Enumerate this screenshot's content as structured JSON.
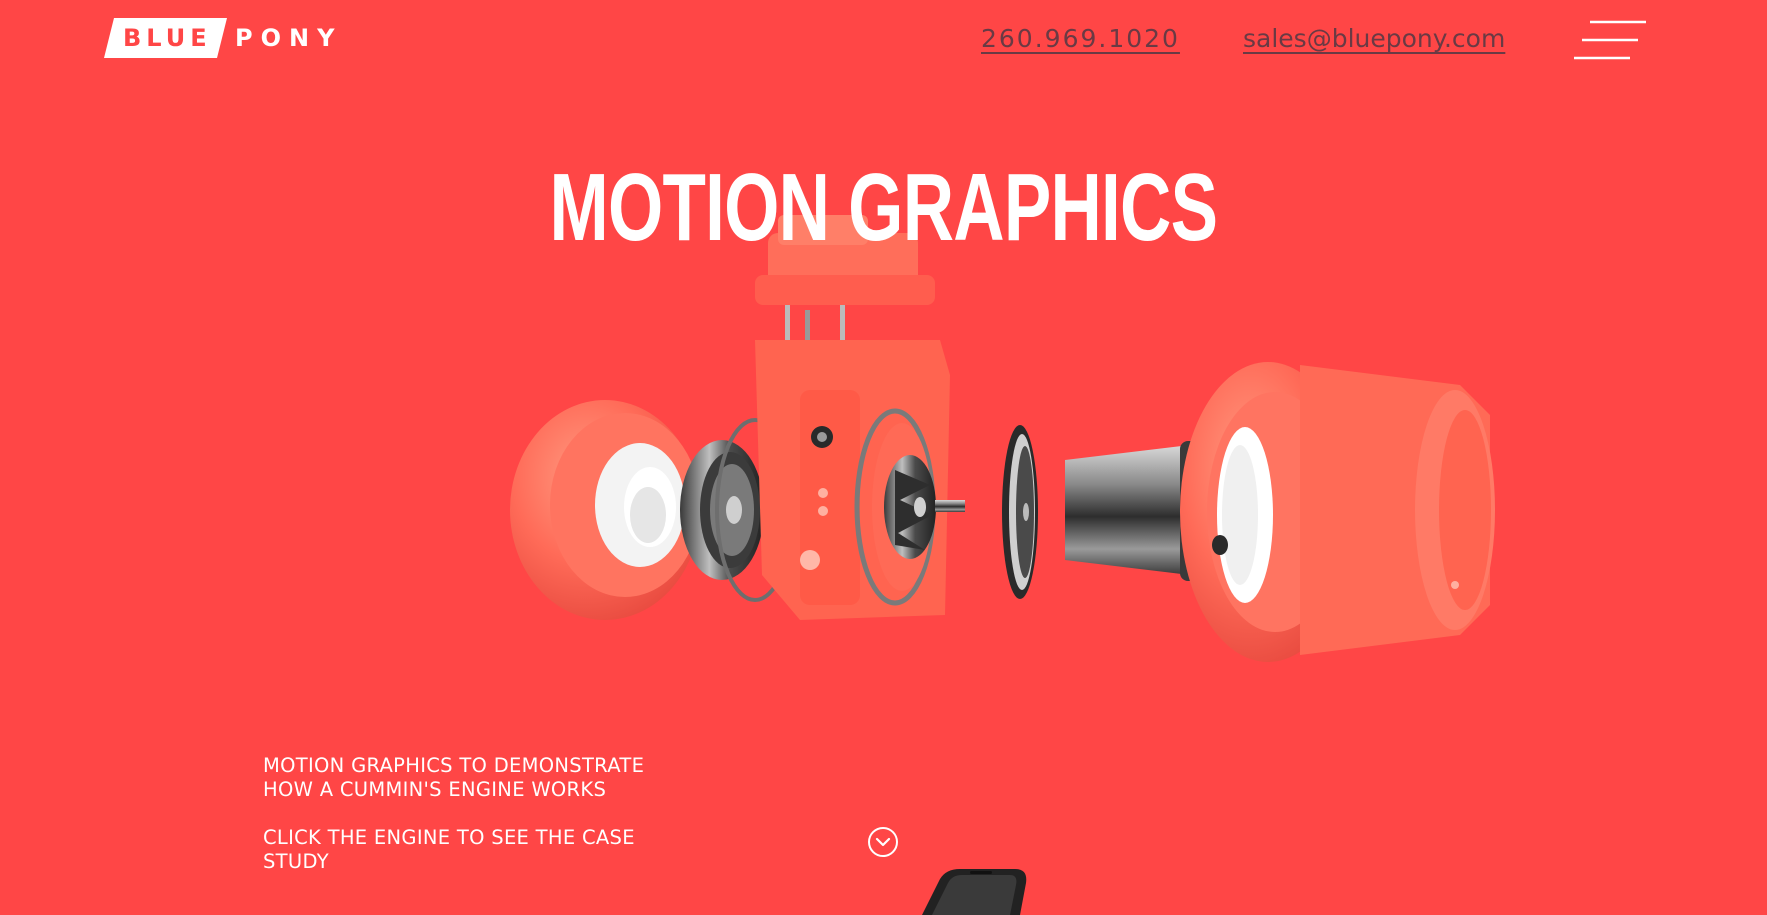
{
  "brand": {
    "logo_part1": "BLUE",
    "logo_part2": "PONY"
  },
  "header": {
    "phone": "260.969.1020",
    "email": "sales@bluepony.com",
    "menu_icon": "hamburger-menu-icon"
  },
  "hero": {
    "title": "MOTION GRAPHICS",
    "image": "exploded-turbocharger-render"
  },
  "description": {
    "line1": "MOTION GRAPHICS TO DEMONSTRATE HOW A CUMMIN'S ENGINE WORKS",
    "line2": "CLICK THE ENGINE TO SEE THE CASE STUDY"
  },
  "scroll": {
    "icon": "chevron-down-circle-icon"
  },
  "colors": {
    "background": "#ff4646",
    "text": "#ffffff",
    "contact_link": "#6a3a44",
    "engine_orange": "#ff6a55"
  }
}
